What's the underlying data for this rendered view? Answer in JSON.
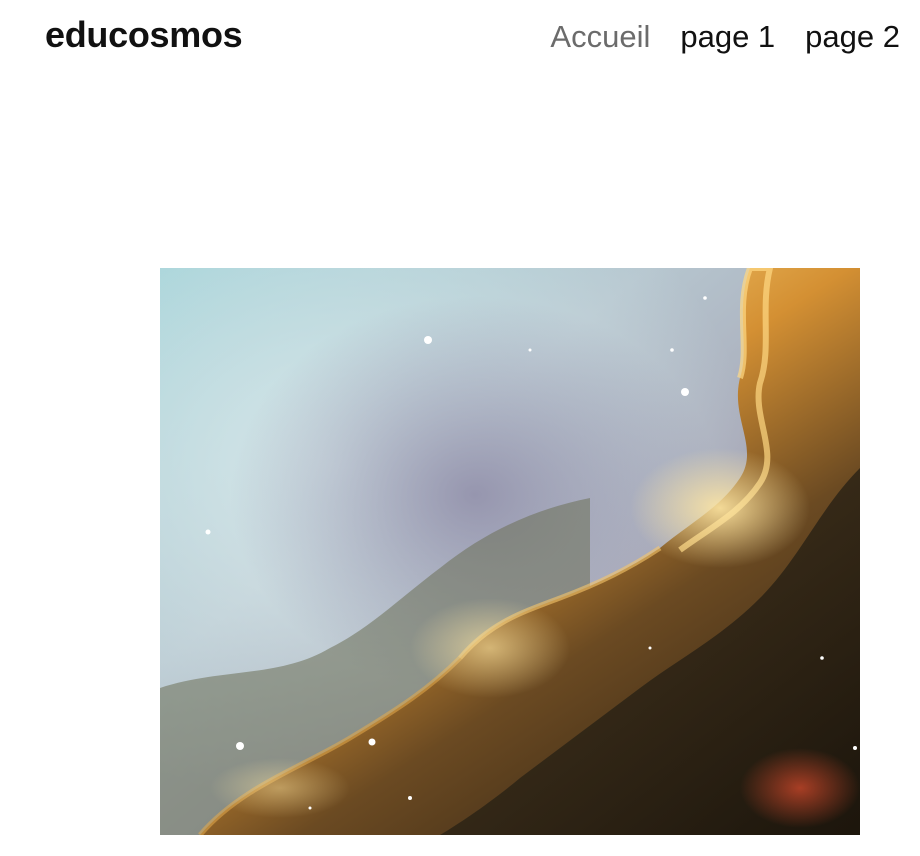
{
  "header": {
    "site_title": "educosmos",
    "nav": [
      {
        "label": "Accueil",
        "current": true
      },
      {
        "label": "page 1",
        "current": false
      },
      {
        "label": "page 2",
        "current": false
      }
    ]
  },
  "main": {
    "image": {
      "subject": "colorful nebula photograph"
    }
  },
  "colors": {
    "text": "#111111",
    "nav_current": "#6b6b6b",
    "background": "#ffffff"
  }
}
